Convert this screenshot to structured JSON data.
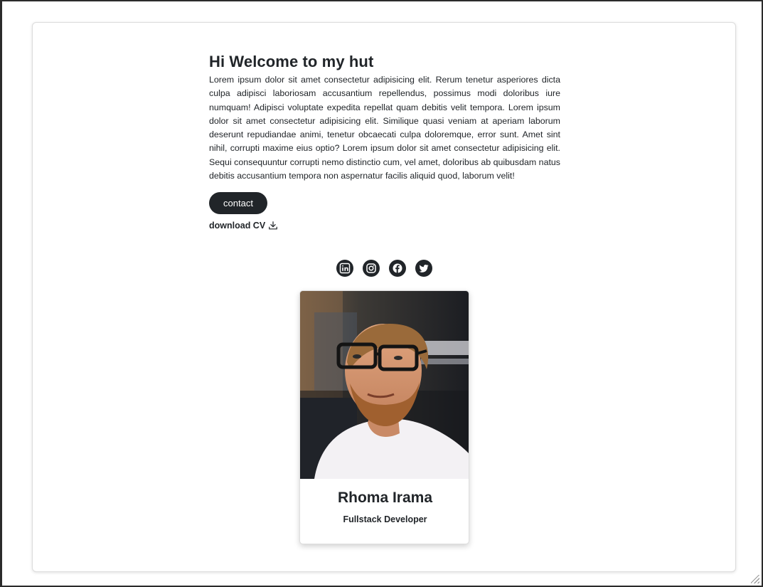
{
  "hero": {
    "title": "Hi Welcome to my hut",
    "paragraph": "Lorem ipsum dolor sit amet consectetur adipisicing elit. Rerum tenetur asperiores dicta culpa adipisci laboriosam accusantium repellendus, possimus modi doloribus iure numquam! Adipisci voluptate expedita repellat quam debitis velit tempora. Lorem ipsum dolor sit amet consectetur adipisicing elit. Similique quasi veniam at aperiam laborum deserunt repudiandae animi, tenetur obcaecati culpa doloremque, error sunt. Amet sint nihil, corrupti maxime eius optio? Lorem ipsum dolor sit amet consectetur adipisicing elit. Sequi consequuntur corrupti nemo distinctio cum, vel amet, doloribus ab quibusdam natus debitis accusantium tempora non aspernatur facilis aliquid quod, laborum velit!",
    "contact_label": "contact",
    "download_label": "download CV",
    "download_icon": "download-icon"
  },
  "socials": [
    {
      "icon": "linkedin-icon"
    },
    {
      "icon": "instagram-icon"
    },
    {
      "icon": "facebook-icon"
    },
    {
      "icon": "twitter-icon"
    }
  ],
  "profile": {
    "name": "Rhoma Irama",
    "role": "Fullstack Developer",
    "photo_icon": "profile-photo"
  },
  "colors": {
    "dark": "#212529",
    "background": "#ffffff",
    "border": "#dcdcdc"
  }
}
